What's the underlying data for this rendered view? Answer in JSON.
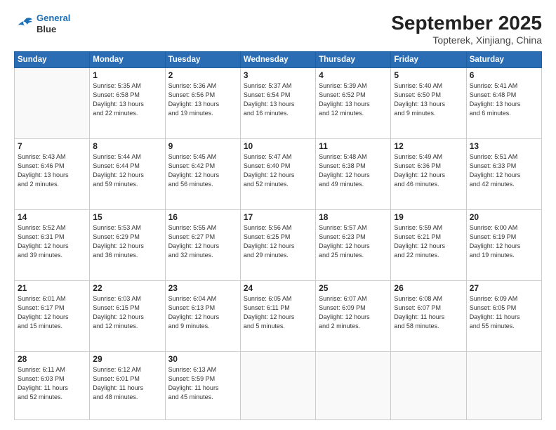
{
  "logo": {
    "line1": "General",
    "line2": "Blue"
  },
  "title": "September 2025",
  "subtitle": "Topterek, Xinjiang, China",
  "weekdays": [
    "Sunday",
    "Monday",
    "Tuesday",
    "Wednesday",
    "Thursday",
    "Friday",
    "Saturday"
  ],
  "weeks": [
    [
      {
        "day": "",
        "info": ""
      },
      {
        "day": "1",
        "info": "Sunrise: 5:35 AM\nSunset: 6:58 PM\nDaylight: 13 hours\nand 22 minutes."
      },
      {
        "day": "2",
        "info": "Sunrise: 5:36 AM\nSunset: 6:56 PM\nDaylight: 13 hours\nand 19 minutes."
      },
      {
        "day": "3",
        "info": "Sunrise: 5:37 AM\nSunset: 6:54 PM\nDaylight: 13 hours\nand 16 minutes."
      },
      {
        "day": "4",
        "info": "Sunrise: 5:39 AM\nSunset: 6:52 PM\nDaylight: 13 hours\nand 12 minutes."
      },
      {
        "day": "5",
        "info": "Sunrise: 5:40 AM\nSunset: 6:50 PM\nDaylight: 13 hours\nand 9 minutes."
      },
      {
        "day": "6",
        "info": "Sunrise: 5:41 AM\nSunset: 6:48 PM\nDaylight: 13 hours\nand 6 minutes."
      }
    ],
    [
      {
        "day": "7",
        "info": "Sunrise: 5:43 AM\nSunset: 6:46 PM\nDaylight: 13 hours\nand 2 minutes."
      },
      {
        "day": "8",
        "info": "Sunrise: 5:44 AM\nSunset: 6:44 PM\nDaylight: 12 hours\nand 59 minutes."
      },
      {
        "day": "9",
        "info": "Sunrise: 5:45 AM\nSunset: 6:42 PM\nDaylight: 12 hours\nand 56 minutes."
      },
      {
        "day": "10",
        "info": "Sunrise: 5:47 AM\nSunset: 6:40 PM\nDaylight: 12 hours\nand 52 minutes."
      },
      {
        "day": "11",
        "info": "Sunrise: 5:48 AM\nSunset: 6:38 PM\nDaylight: 12 hours\nand 49 minutes."
      },
      {
        "day": "12",
        "info": "Sunrise: 5:49 AM\nSunset: 6:36 PM\nDaylight: 12 hours\nand 46 minutes."
      },
      {
        "day": "13",
        "info": "Sunrise: 5:51 AM\nSunset: 6:33 PM\nDaylight: 12 hours\nand 42 minutes."
      }
    ],
    [
      {
        "day": "14",
        "info": "Sunrise: 5:52 AM\nSunset: 6:31 PM\nDaylight: 12 hours\nand 39 minutes."
      },
      {
        "day": "15",
        "info": "Sunrise: 5:53 AM\nSunset: 6:29 PM\nDaylight: 12 hours\nand 36 minutes."
      },
      {
        "day": "16",
        "info": "Sunrise: 5:55 AM\nSunset: 6:27 PM\nDaylight: 12 hours\nand 32 minutes."
      },
      {
        "day": "17",
        "info": "Sunrise: 5:56 AM\nSunset: 6:25 PM\nDaylight: 12 hours\nand 29 minutes."
      },
      {
        "day": "18",
        "info": "Sunrise: 5:57 AM\nSunset: 6:23 PM\nDaylight: 12 hours\nand 25 minutes."
      },
      {
        "day": "19",
        "info": "Sunrise: 5:59 AM\nSunset: 6:21 PM\nDaylight: 12 hours\nand 22 minutes."
      },
      {
        "day": "20",
        "info": "Sunrise: 6:00 AM\nSunset: 6:19 PM\nDaylight: 12 hours\nand 19 minutes."
      }
    ],
    [
      {
        "day": "21",
        "info": "Sunrise: 6:01 AM\nSunset: 6:17 PM\nDaylight: 12 hours\nand 15 minutes."
      },
      {
        "day": "22",
        "info": "Sunrise: 6:03 AM\nSunset: 6:15 PM\nDaylight: 12 hours\nand 12 minutes."
      },
      {
        "day": "23",
        "info": "Sunrise: 6:04 AM\nSunset: 6:13 PM\nDaylight: 12 hours\nand 9 minutes."
      },
      {
        "day": "24",
        "info": "Sunrise: 6:05 AM\nSunset: 6:11 PM\nDaylight: 12 hours\nand 5 minutes."
      },
      {
        "day": "25",
        "info": "Sunrise: 6:07 AM\nSunset: 6:09 PM\nDaylight: 12 hours\nand 2 minutes."
      },
      {
        "day": "26",
        "info": "Sunrise: 6:08 AM\nSunset: 6:07 PM\nDaylight: 11 hours\nand 58 minutes."
      },
      {
        "day": "27",
        "info": "Sunrise: 6:09 AM\nSunset: 6:05 PM\nDaylight: 11 hours\nand 55 minutes."
      }
    ],
    [
      {
        "day": "28",
        "info": "Sunrise: 6:11 AM\nSunset: 6:03 PM\nDaylight: 11 hours\nand 52 minutes."
      },
      {
        "day": "29",
        "info": "Sunrise: 6:12 AM\nSunset: 6:01 PM\nDaylight: 11 hours\nand 48 minutes."
      },
      {
        "day": "30",
        "info": "Sunrise: 6:13 AM\nSunset: 5:59 PM\nDaylight: 11 hours\nand 45 minutes."
      },
      {
        "day": "",
        "info": ""
      },
      {
        "day": "",
        "info": ""
      },
      {
        "day": "",
        "info": ""
      },
      {
        "day": "",
        "info": ""
      }
    ]
  ]
}
